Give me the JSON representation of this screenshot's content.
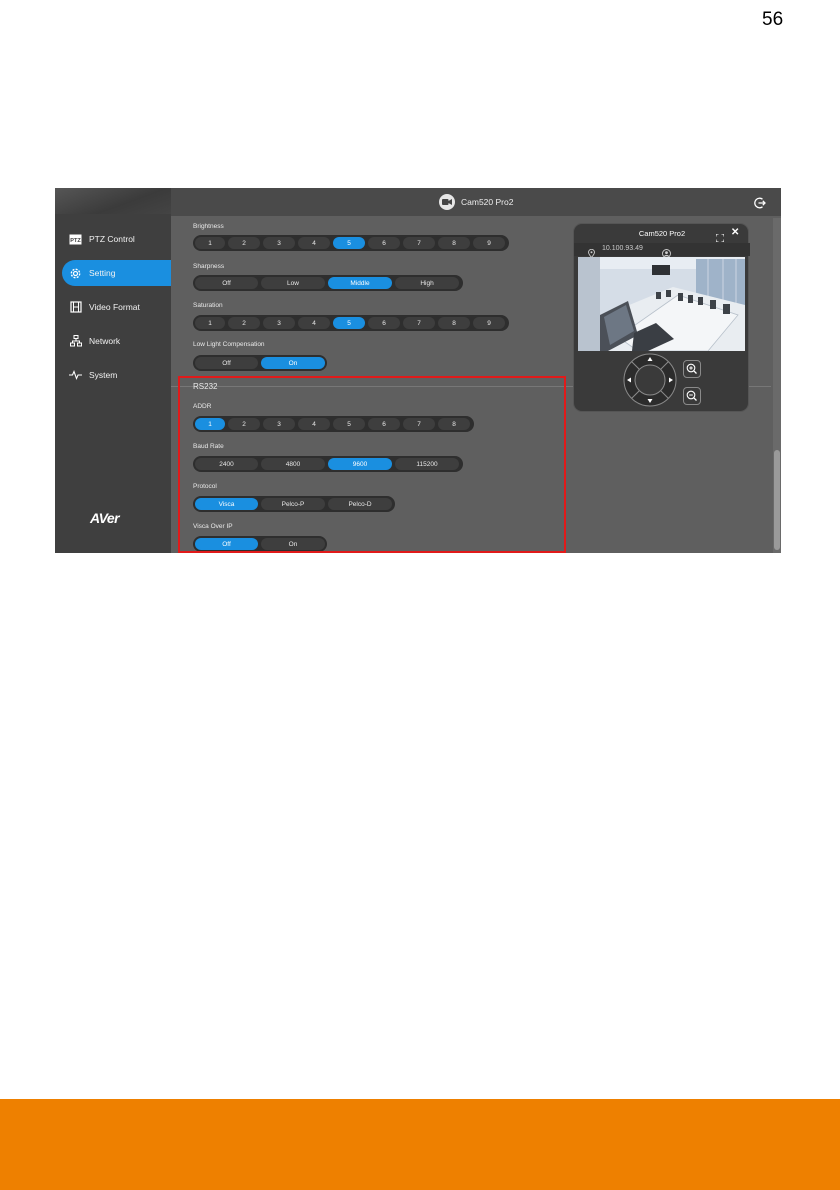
{
  "page_number": "56",
  "app": {
    "camera_name": "Cam520 Pro2",
    "sidebar": {
      "items": [
        {
          "label": "PTZ Control",
          "icon": "ptz-icon",
          "active": false
        },
        {
          "label": "Setting",
          "icon": "gear-icon",
          "active": true
        },
        {
          "label": "Video Format",
          "icon": "film-icon",
          "active": false
        },
        {
          "label": "Network",
          "icon": "network-icon",
          "active": false
        },
        {
          "label": "System",
          "icon": "pulse-icon",
          "active": false
        }
      ],
      "logo": "AVer"
    },
    "settings": {
      "brightness": {
        "label": "Brightness",
        "options": [
          "1",
          "2",
          "3",
          "4",
          "5",
          "6",
          "7",
          "8",
          "9"
        ],
        "selected": "5"
      },
      "sharpness": {
        "label": "Sharpness",
        "options": [
          "Off",
          "Low",
          "Middle",
          "High"
        ],
        "selected": "Middle"
      },
      "saturation": {
        "label": "Saturation",
        "options": [
          "1",
          "2",
          "3",
          "4",
          "5",
          "6",
          "7",
          "8",
          "9"
        ],
        "selected": "5"
      },
      "low_light": {
        "label": "Low Light Compensation",
        "options": [
          "Off",
          "On"
        ],
        "selected": "On"
      }
    },
    "rs232": {
      "heading": "RS232",
      "addr": {
        "label": "ADDR",
        "options": [
          "1",
          "2",
          "3",
          "4",
          "5",
          "6",
          "7",
          "8"
        ],
        "selected": "1"
      },
      "baud_rate": {
        "label": "Baud Rate",
        "options": [
          "2400",
          "4800",
          "9600",
          "115200"
        ],
        "selected": "9600"
      },
      "protocol": {
        "label": "Protocol",
        "options": [
          "Visca",
          "Pelco-P",
          "Pelco-D"
        ],
        "selected": "Visca"
      },
      "visca_over_ip": {
        "label": "Visca Over IP",
        "options": [
          "Off",
          "On"
        ],
        "selected": "Off"
      }
    },
    "preview": {
      "title": "Cam520 Pro2",
      "ip": "10.100.93.49"
    }
  },
  "colors": {
    "accent": "#1a8fe0",
    "highlight_box": "#e11a1a",
    "footer": "#ee8000",
    "panel_bg": "#5f5f5f",
    "sidebar_bg": "#3f3f3f"
  }
}
